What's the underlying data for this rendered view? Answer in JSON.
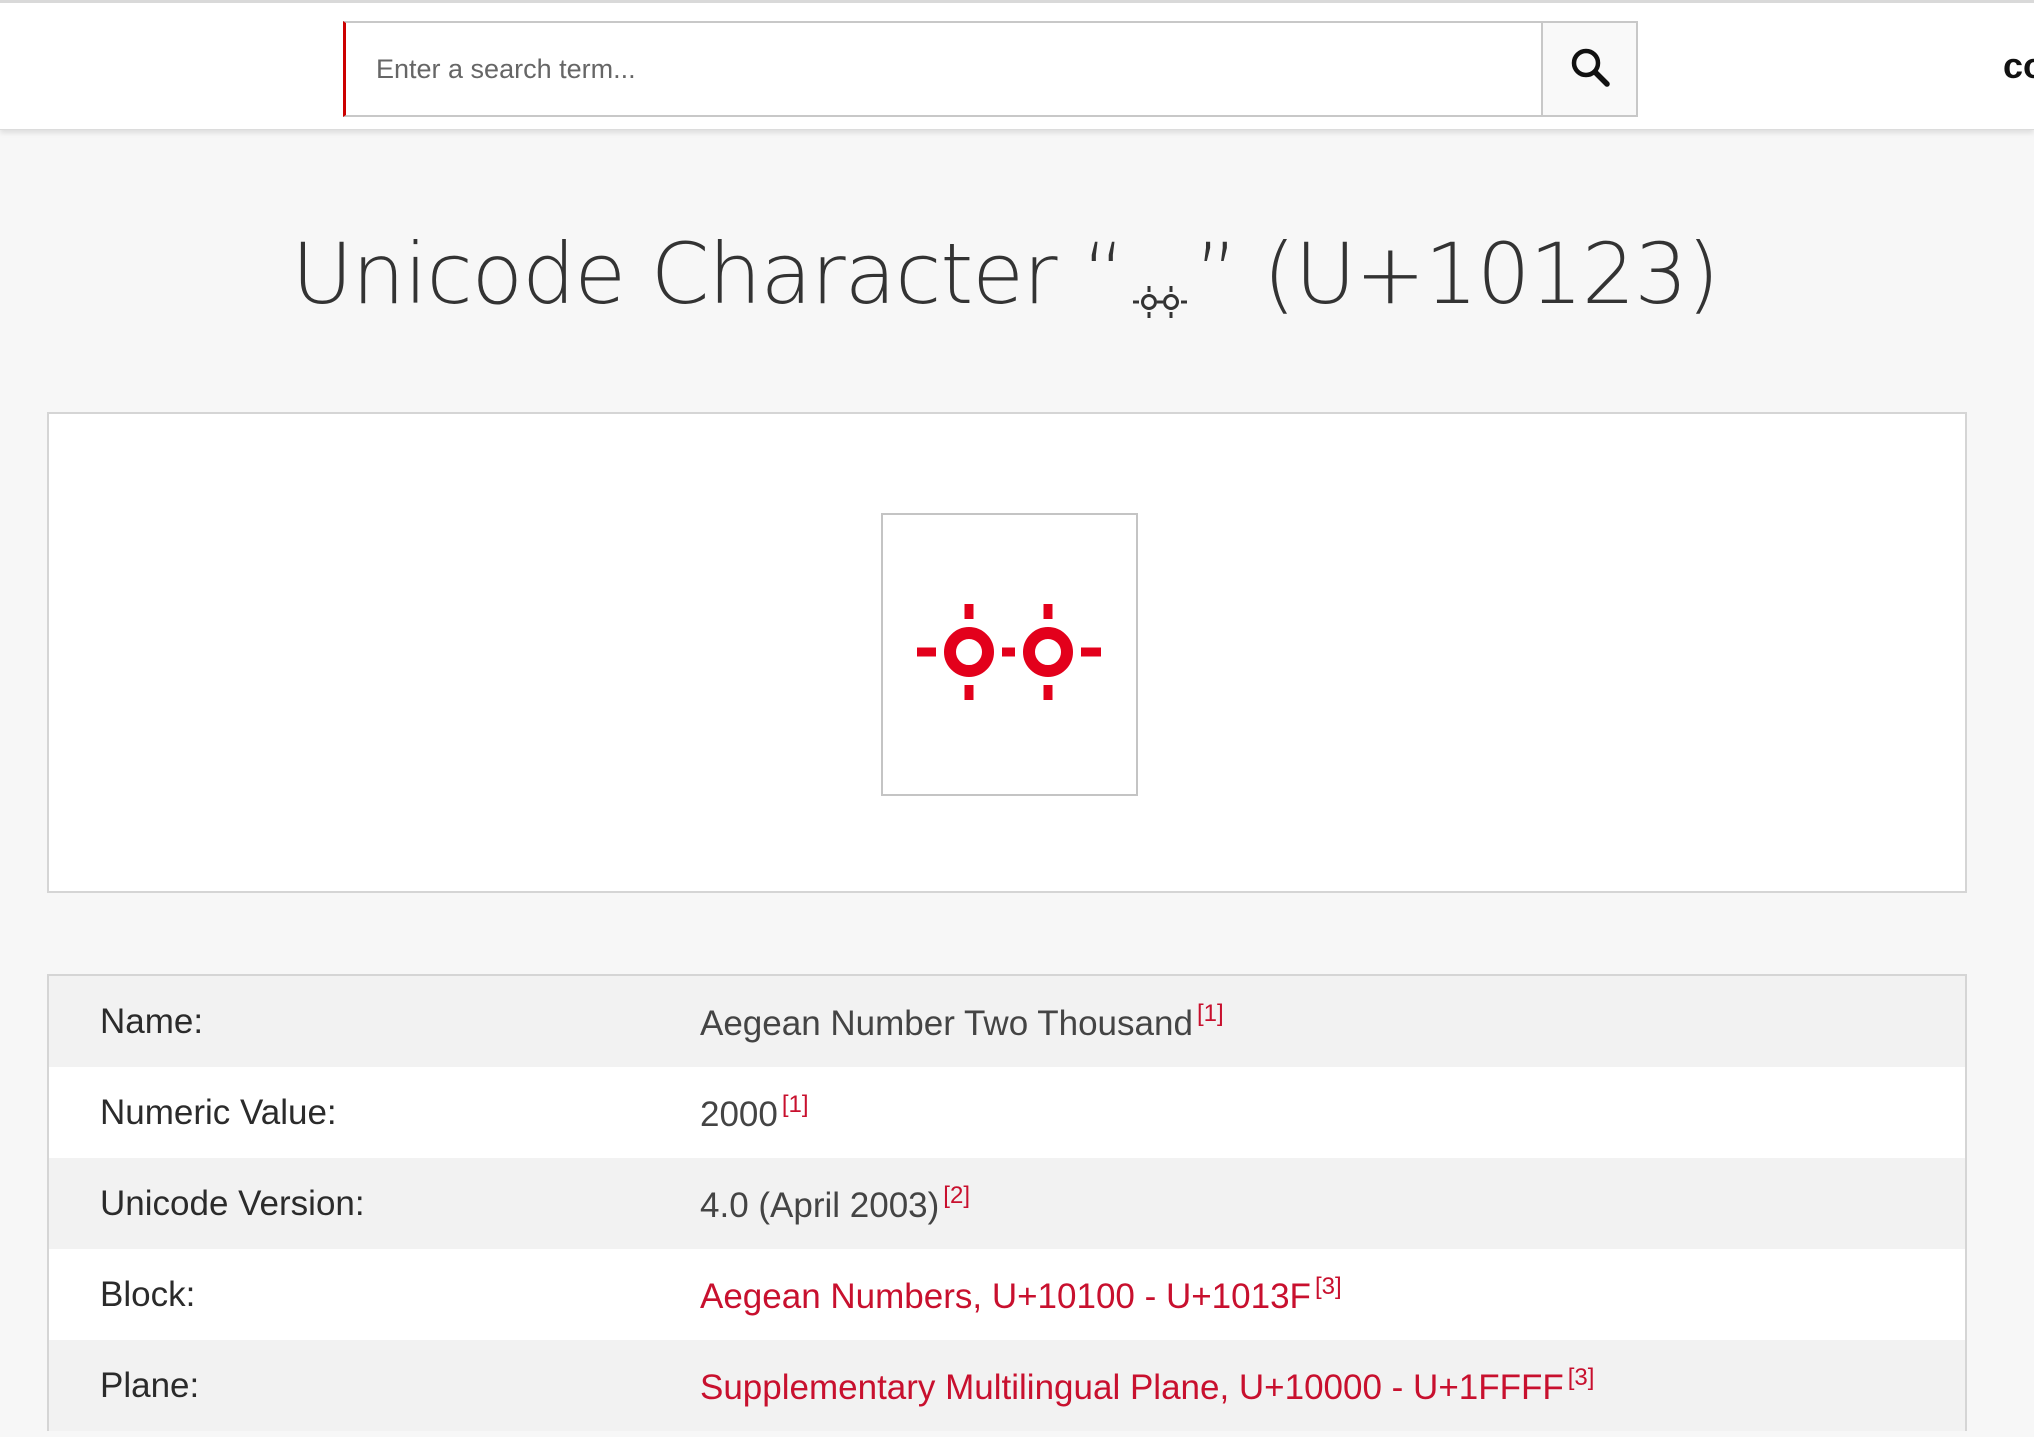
{
  "header": {
    "search_placeholder": "Enter a search term...",
    "brand_fragment": "co"
  },
  "colors": {
    "accent": "#cc0000",
    "link": "#c8102e",
    "glyph": "#e3001b"
  },
  "title": {
    "prefix": "Unicode Character “",
    "suffix": "” (U+10123)",
    "glyph_icon": "aegean-number-two-thousand-glyph"
  },
  "preview": {
    "glyph_icon": "aegean-number-two-thousand-glyph"
  },
  "properties": [
    {
      "label": "Name:",
      "value": "Aegean Number Two Thousand",
      "ref": "[1]",
      "is_link": false
    },
    {
      "label": "Numeric Value:",
      "value": "2000",
      "ref": "[1]",
      "is_link": false
    },
    {
      "label": "Unicode Version:",
      "value": "4.0 (April 2003)",
      "ref": "[2]",
      "is_link": false
    },
    {
      "label": "Block:",
      "value": "Aegean Numbers, U+10100 - U+1013F",
      "ref": "[3]",
      "is_link": true
    },
    {
      "label": "Plane:",
      "value": "Supplementary Multilingual Plane, U+10000 - U+1FFFF",
      "ref": "[3]",
      "is_link": true
    }
  ]
}
